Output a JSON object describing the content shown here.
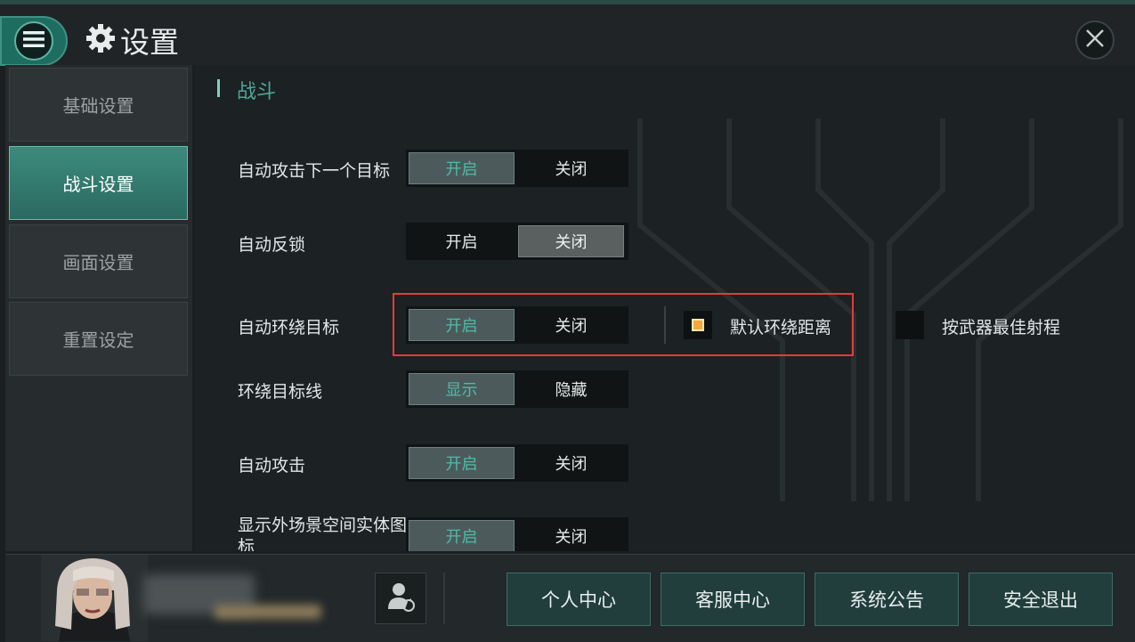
{
  "header": {
    "title": "设置"
  },
  "sidebar": {
    "items": [
      {
        "label": "基础设置"
      },
      {
        "label": "战斗设置"
      },
      {
        "label": "画面设置"
      },
      {
        "label": "重置设定"
      }
    ]
  },
  "main": {
    "section_title": "战斗",
    "settings": [
      {
        "label": "自动攻击下一个目标",
        "options": [
          "开启",
          "关闭"
        ],
        "selected": "开启"
      },
      {
        "label": "自动反锁",
        "options": [
          "开启",
          "关闭"
        ],
        "selected": "关闭"
      },
      {
        "label": "自动环绕目标",
        "options": [
          "开启",
          "关闭"
        ],
        "selected": "开启"
      },
      {
        "label": "环绕目标线",
        "options": [
          "显示",
          "隐藏"
        ],
        "selected": "显示"
      },
      {
        "label": "自动攻击",
        "options": [
          "开启",
          "关闭"
        ],
        "selected": "开启"
      },
      {
        "label": "显示外场景空间实体图标",
        "options": [
          "开启",
          "关闭"
        ],
        "selected": "开启"
      }
    ],
    "orbit_options": [
      {
        "label": "默认环绕距离",
        "checked": true
      },
      {
        "label": "按武器最佳射程",
        "checked": false
      }
    ]
  },
  "footer": {
    "buttons": [
      {
        "label": "个人中心"
      },
      {
        "label": "客服中心"
      },
      {
        "label": "系统公告"
      },
      {
        "label": "安全退出"
      }
    ]
  },
  "colors": {
    "accent": "#4cbca8",
    "highlight_box": "#e23b3b",
    "checkbox_on": "#f7a83a"
  },
  "icons": [
    "menu-icon",
    "gear-icon",
    "close-icon",
    "switch-account-icon"
  ]
}
